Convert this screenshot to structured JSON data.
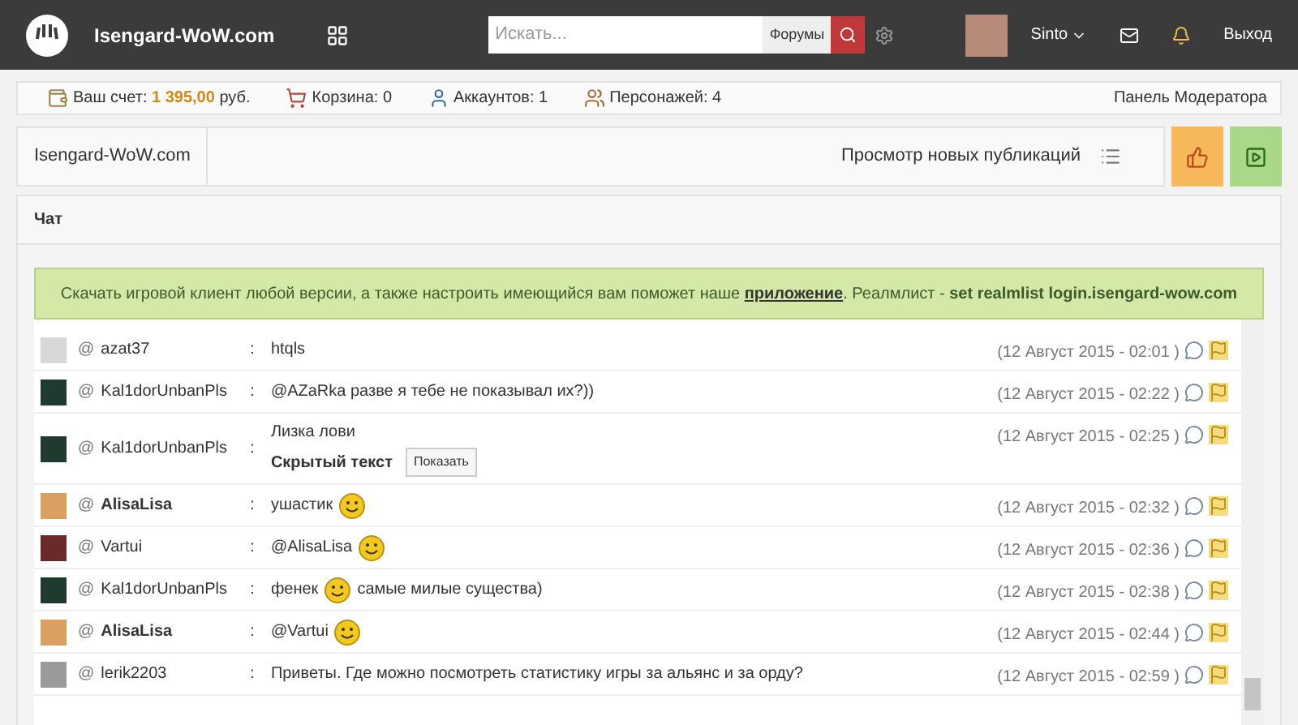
{
  "header": {
    "site_name": "Isengard-WoW.com",
    "search": {
      "placeholder": "Искать...",
      "scope": "Форумы"
    },
    "user": "Sinto",
    "logout": "Выход"
  },
  "account_bar": {
    "items": [
      {
        "kind": "balance",
        "label": "Ваш счет:",
        "value": "1 395,00",
        "unit": "руб."
      },
      {
        "kind": "cart",
        "label": "Корзина: 0"
      },
      {
        "kind": "accounts",
        "label": "Аккаунтов: 1"
      },
      {
        "kind": "characters",
        "label": "Персонажей: 4"
      }
    ],
    "moderator_link": "Панель Модератора"
  },
  "breadcrumb": {
    "items": [
      "Isengard-WoW.com"
    ],
    "new_posts": "Просмотр новых публикаций"
  },
  "chat": {
    "title": "Чат",
    "notice": {
      "text": "Скачать игровой клиент любой версии, а также настроить имеющийся вам поможет наше",
      "link": "приложение",
      "after": ". Реалмлист -",
      "realmlist": "set realmlist login.isengard-wow.com"
    },
    "messages": [
      {
        "color": "#d8d8d8",
        "at": "@",
        "user": "azat37",
        "bold": false,
        "colon": ":",
        "parts": [
          {
            "kind": "text",
            "text": "htqls"
          }
        ],
        "time": "(12 Август 2015 - 02:01 )"
      },
      {
        "color": "#1f3a2e",
        "at": "@",
        "user": "Kal1dorUnbanPls",
        "bold": false,
        "colon": ":",
        "parts": [
          {
            "kind": "text",
            "text": "@AZaRka разве я тебе не показывал их?))"
          }
        ],
        "time": "(12 Август 2015 - 02:22 )"
      },
      {
        "color": "#1f3a2e",
        "at": "@",
        "user": "Kal1dorUnbanPls",
        "bold": false,
        "colon": ":",
        "parts": [
          {
            "kind": "text",
            "text": "Лизка лови"
          },
          {
            "kind": "hidden",
            "label": "Скрытый текст",
            "button": "Показать"
          }
        ],
        "time": "(12 Август 2015 - 02:25 )"
      },
      {
        "color": "#d9a062",
        "at": "@",
        "user": "AlisaLisa",
        "bold": true,
        "colon": ":",
        "parts": [
          {
            "kind": "text",
            "text": "ушастик"
          },
          {
            "kind": "smiley"
          }
        ],
        "time": "(12 Август 2015 - 02:32 )"
      },
      {
        "color": "#6b2a2a",
        "at": "@",
        "user": "Vartui",
        "bold": false,
        "colon": ":",
        "parts": [
          {
            "kind": "text",
            "text": "@AlisaLisa"
          },
          {
            "kind": "smiley"
          }
        ],
        "time": "(12 Август 2015 - 02:36 )"
      },
      {
        "color": "#1f3a2e",
        "at": "@",
        "user": "Kal1dorUnbanPls",
        "bold": false,
        "colon": ":",
        "parts": [
          {
            "kind": "text",
            "text": "фенек"
          },
          {
            "kind": "smiley"
          },
          {
            "kind": "text",
            "text": "самые милые существа)"
          }
        ],
        "time": "(12 Август 2015 - 02:38 )"
      },
      {
        "color": "#d9a062",
        "at": "@",
        "user": "AlisaLisa",
        "bold": true,
        "colon": ":",
        "parts": [
          {
            "kind": "text",
            "text": "@Vartui"
          },
          {
            "kind": "smiley"
          }
        ],
        "time": "(12 Август 2015 - 02:44 )"
      },
      {
        "color": "#9a9a9a",
        "at": "@",
        "user": "lerik2203",
        "bold": false,
        "colon": ":",
        "parts": [
          {
            "kind": "text",
            "text": "Приветы. Где можно посмотреть статистику игры за альянс и за орду?"
          }
        ],
        "time": "(12 Август 2015 - 02:59 )"
      }
    ]
  }
}
